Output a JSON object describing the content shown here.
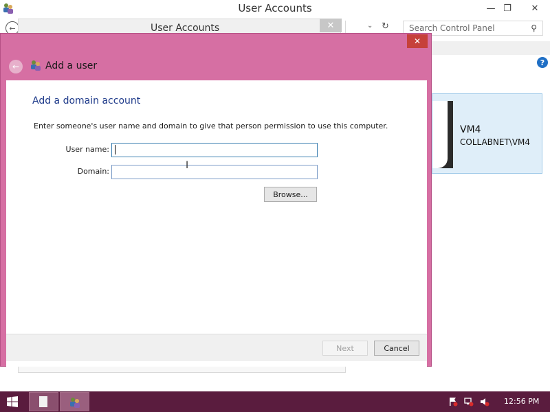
{
  "window": {
    "title": "User Accounts",
    "address_title": "User Accounts",
    "search_placeholder": "Search Control Panel",
    "minimize": "—",
    "restore": "❐",
    "close": "✕"
  },
  "background_user": {
    "name": "VM4",
    "domain_user": "COLLABNET\\VM4"
  },
  "dialog": {
    "title": "Add a user",
    "heading": "Add a domain account",
    "description": "Enter someone's user name and domain to give that person permission to use this computer.",
    "fields": {
      "username_label": "User name:",
      "username_value": "",
      "domain_label": "Domain:",
      "domain_value": ""
    },
    "browse_label": "Browse...",
    "next_label": "Next",
    "cancel_label": "Cancel",
    "close_glyph": "✕"
  },
  "taskbar": {
    "time": "12:56 PM"
  },
  "colors": {
    "dialog_frame": "#d66fa3",
    "taskbar": "#5a1c3e",
    "heading": "#1e3a8a",
    "close_red": "#c6413a"
  }
}
